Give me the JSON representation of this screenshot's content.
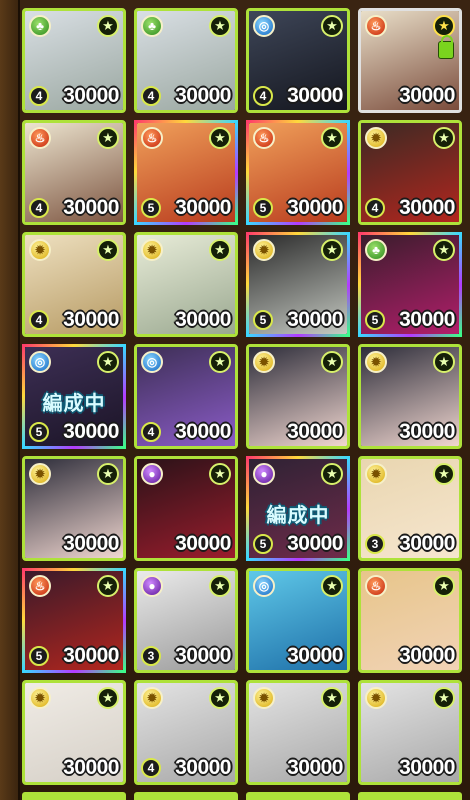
{
  "colors": {
    "background": "#2b190b",
    "frame_green": "#aee23a",
    "fire": "#c3240c",
    "wood": "#2a8a1c",
    "water": "#1266c2",
    "light": "#d9a90a",
    "dark": "#5b1598"
  },
  "cards": [
    {
      "element": "wood",
      "element_icon": "leaf-icon",
      "rarity": "4",
      "points": "30000",
      "art": [
        "#d9dfe4",
        "#9aa7a0"
      ],
      "banner": ""
    },
    {
      "element": "wood",
      "element_icon": "leaf-icon",
      "rarity": "4",
      "points": "30000",
      "art": [
        "#d9dfe4",
        "#9aa7a0"
      ],
      "banner": ""
    },
    {
      "element": "water",
      "element_icon": "water-icon",
      "rarity": "4",
      "points": "30000",
      "art": [
        "#3e4658",
        "#14161e"
      ],
      "banner": ""
    },
    {
      "element": "fire",
      "element_icon": "fire-icon",
      "rarity": "",
      "points": "30000",
      "art": [
        "#e9dfc9",
        "#7a4b3b"
      ],
      "banner": "",
      "locked": true
    },
    {
      "element": "fire",
      "element_icon": "fire-icon",
      "rarity": "4",
      "points": "30000",
      "art": [
        "#ece4cf",
        "#7c5440"
      ],
      "banner": ""
    },
    {
      "element": "fire",
      "element_icon": "fire-icon",
      "rarity": "5",
      "points": "30000",
      "art": [
        "#f0a05a",
        "#b83b1e"
      ],
      "banner": ""
    },
    {
      "element": "fire",
      "element_icon": "fire-icon",
      "rarity": "5",
      "points": "30000",
      "art": [
        "#f0a05a",
        "#b83b1e"
      ],
      "banner": ""
    },
    {
      "element": "light",
      "element_icon": "sun-icon",
      "rarity": "4",
      "points": "30000",
      "art": [
        "#3b2a24",
        "#b3261e"
      ],
      "banner": ""
    },
    {
      "element": "light",
      "element_icon": "sun-icon",
      "rarity": "4",
      "points": "30000",
      "art": [
        "#eee0c0",
        "#b69a63"
      ],
      "banner": ""
    },
    {
      "element": "light",
      "element_icon": "sun-icon",
      "rarity": "",
      "points": "30000",
      "art": [
        "#e8ecd8",
        "#9aa890"
      ],
      "banner": ""
    },
    {
      "element": "light",
      "element_icon": "sun-icon",
      "rarity": "5",
      "points": "30000",
      "art": [
        "#2a2a2a",
        "#c5c9c2"
      ],
      "banner": ""
    },
    {
      "element": "wood",
      "element_icon": "leaf-icon",
      "rarity": "5",
      "points": "30000",
      "art": [
        "#3a1d2c",
        "#b21e6b"
      ],
      "banner": ""
    },
    {
      "element": "water",
      "element_icon": "water-icon",
      "rarity": "5",
      "points": "30000",
      "art": [
        "#3d2f55",
        "#1b1426"
      ],
      "banner": "編成中"
    },
    {
      "element": "water",
      "element_icon": "water-icon",
      "rarity": "4",
      "points": "30000",
      "art": [
        "#3d2f55",
        "#8b5cc8"
      ],
      "banner": ""
    },
    {
      "element": "light",
      "element_icon": "sun-icon",
      "rarity": "",
      "points": "30000",
      "art": [
        "#2d2d3a",
        "#f1d7d0"
      ],
      "banner": ""
    },
    {
      "element": "light",
      "element_icon": "sun-icon",
      "rarity": "",
      "points": "30000",
      "art": [
        "#2d2d3a",
        "#f1d7d0"
      ],
      "banner": ""
    },
    {
      "element": "light",
      "element_icon": "sun-icon",
      "rarity": "",
      "points": "30000",
      "art": [
        "#2d2d3a",
        "#f1d7d0"
      ],
      "banner": ""
    },
    {
      "element": "dark",
      "element_icon": "moon-icon",
      "rarity": "",
      "points": "30000",
      "art": [
        "#2a1218",
        "#9b1d2d"
      ],
      "banner": ""
    },
    {
      "element": "dark",
      "element_icon": "moon-icon",
      "rarity": "5",
      "points": "30000",
      "art": [
        "#2e2234",
        "#6f2b4a"
      ],
      "banner": "編成中"
    },
    {
      "element": "light",
      "element_icon": "sun-icon",
      "rarity": "3",
      "points": "30000",
      "art": [
        "#e9d6b0",
        "#f6e6cf"
      ],
      "banner": ""
    },
    {
      "element": "fire",
      "element_icon": "fire-icon",
      "rarity": "5",
      "points": "30000",
      "art": [
        "#3a1a2a",
        "#b3261e"
      ],
      "banner": ""
    },
    {
      "element": "dark",
      "element_icon": "moon-icon",
      "rarity": "3",
      "points": "30000",
      "art": [
        "#eaeaea",
        "#9a9a9a"
      ],
      "banner": ""
    },
    {
      "element": "water",
      "element_icon": "water-icon",
      "rarity": "",
      "points": "30000",
      "art": [
        "#5fc8e8",
        "#1e6fa8"
      ],
      "banner": ""
    },
    {
      "element": "fire",
      "element_icon": "fire-icon",
      "rarity": "",
      "points": "30000",
      "art": [
        "#e7c58a",
        "#f1d3b6"
      ],
      "banner": ""
    },
    {
      "element": "light",
      "element_icon": "sun-icon",
      "rarity": "",
      "points": "30000",
      "art": [
        "#f0ece6",
        "#d5cfc6"
      ],
      "banner": ""
    },
    {
      "element": "light",
      "element_icon": "sun-icon",
      "rarity": "4",
      "points": "30000",
      "art": [
        "#e3e3e3",
        "#a8a8a8"
      ],
      "banner": ""
    },
    {
      "element": "light",
      "element_icon": "sun-icon",
      "rarity": "",
      "points": "30000",
      "art": [
        "#e3e3e3",
        "#a8a8a8"
      ],
      "banner": ""
    },
    {
      "element": "light",
      "element_icon": "sun-icon",
      "rarity": "",
      "points": "30000",
      "art": [
        "#e3e3e3",
        "#a8a8a8"
      ],
      "banner": ""
    }
  ],
  "favorite_icon": "★"
}
